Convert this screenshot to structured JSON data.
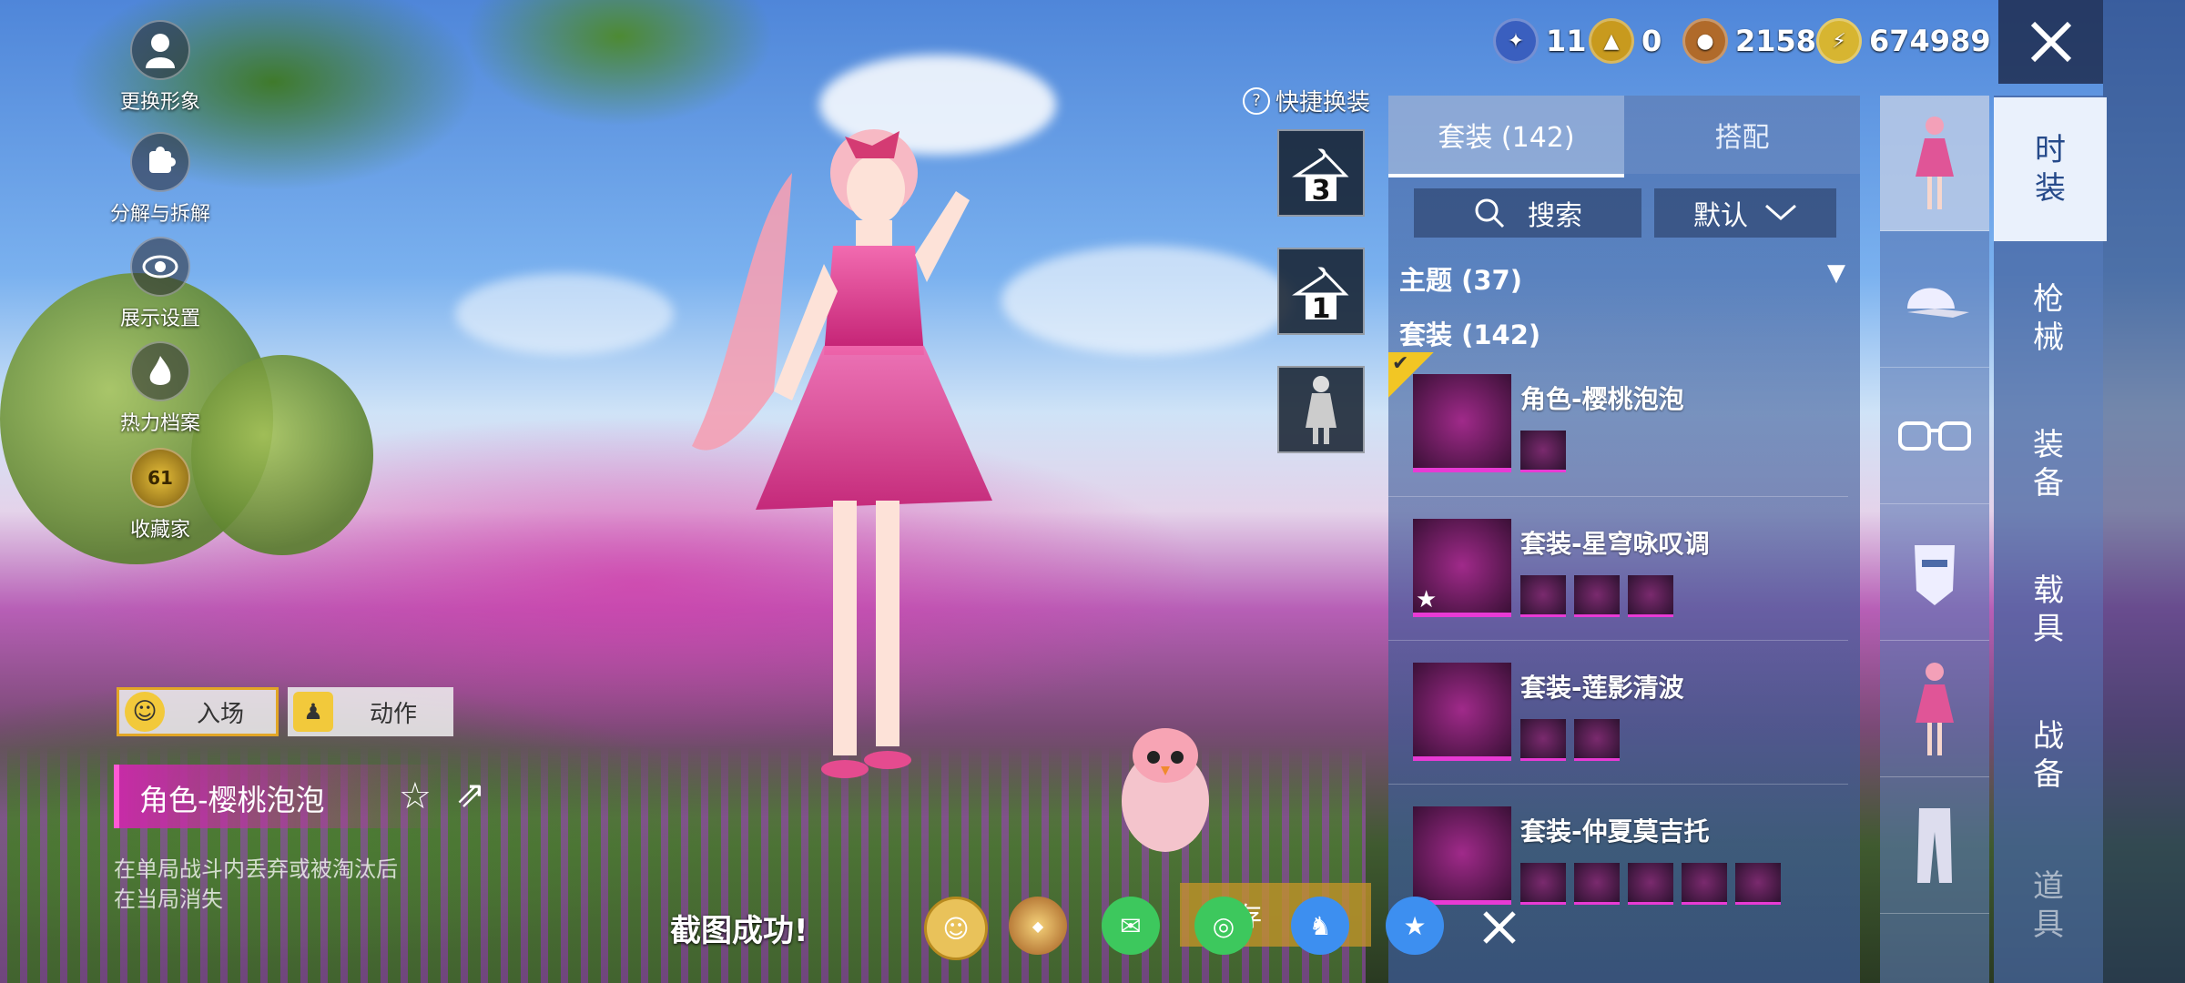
{
  "currencies": [
    {
      "icon": "blue-medal-icon",
      "value": "11",
      "color": "#3a5fbf"
    },
    {
      "icon": "gold-triangle-coin-icon",
      "value": "0",
      "color": "#c89a1e"
    },
    {
      "icon": "bronze-coin-icon",
      "value": "2158",
      "color": "#b06a2a"
    },
    {
      "icon": "gold-lightning-coin-icon",
      "value": "674989",
      "color": "#d7b531"
    }
  ],
  "left_menu": [
    {
      "label": "更换形象",
      "icon": "avatar-icon"
    },
    {
      "label": "分解与拆解",
      "icon": "puzzle-icon"
    },
    {
      "label": "展示设置",
      "icon": "eye-icon"
    },
    {
      "label": "热力档案",
      "icon": "flame-icon"
    },
    {
      "label": "收藏家",
      "icon": "collector-badge-icon",
      "badge": "61"
    }
  ],
  "actions": {
    "entrance": "入场",
    "emote": "动作"
  },
  "selected_outfit": {
    "name": "角色-樱桃泡泡",
    "note_line1": "在单局战斗内丢弃或被淘汰后",
    "note_line2": "在当局消失"
  },
  "quick_change": {
    "label": "快捷换装",
    "slot1": "3",
    "slot2": "1"
  },
  "panel": {
    "tab_sets": "套装 (142)",
    "tab_match": "搭配",
    "search_label": "搜索",
    "sort_label": "默认",
    "theme_row": "主题 (37)",
    "sets_row": "套装 (142)",
    "items": [
      {
        "title": "角色-樱桃泡泡",
        "subs": 1
      },
      {
        "title": "套装-星穹咏叹调",
        "subs": 3
      },
      {
        "title": "套装-莲影清波",
        "subs": 2
      },
      {
        "title": "套装-仲夏莫吉托",
        "subs": 5
      }
    ]
  },
  "nav": [
    "时装",
    "枪械",
    "装备",
    "载具",
    "战备",
    "道具"
  ],
  "toast": "截图成功!",
  "share_icons": [
    "friend-share-icon",
    "peace-elite-icon",
    "wechat-icon",
    "moments-icon",
    "qq-icon",
    "qzone-icon"
  ],
  "bottom_obscured": "存"
}
